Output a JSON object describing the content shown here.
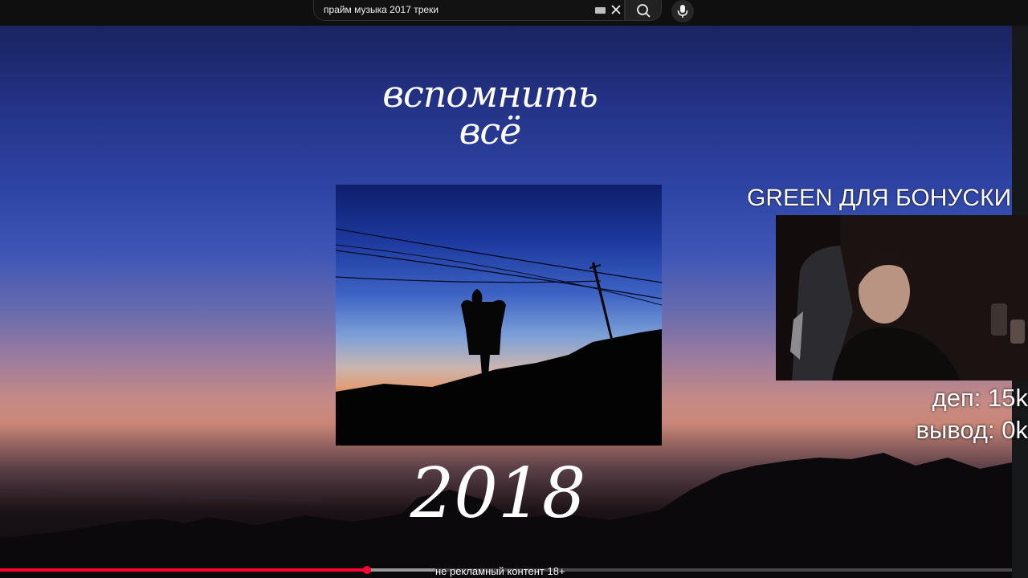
{
  "search": {
    "query": "прайм музыка 2017 треки",
    "clear_icon": "close-icon",
    "search_icon": "search-icon",
    "mic_icon": "mic-icon",
    "keyboard_icon": "keyboard-icon"
  },
  "video": {
    "title": "вспомнить всё",
    "year": "2018",
    "progress": 0.363,
    "buffered": 0.43
  },
  "overlay": {
    "promo": "GREEN ДЛЯ БОНУСКИ",
    "deposit": "деп: 15k",
    "withdrawal": "вывод: 0k",
    "disclaimer": "не рекламный контент 18+"
  },
  "colors": {
    "accent": "#ff0033",
    "topbar": "#0f0f0f"
  }
}
